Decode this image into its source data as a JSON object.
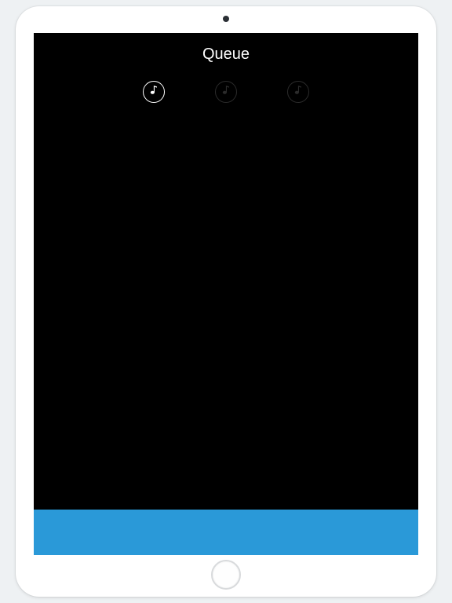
{
  "header": {
    "title": "Queue"
  },
  "queueTabs": {
    "items": [
      {
        "icon": "music-note-icon",
        "active": true
      },
      {
        "icon": "music-note-icon",
        "active": false
      },
      {
        "icon": "music-note-icon",
        "active": false
      }
    ]
  },
  "colors": {
    "accent": "#2a99d8",
    "background": "#000000",
    "textLight": "#ffffff",
    "inactive": "#2b2b2b"
  }
}
